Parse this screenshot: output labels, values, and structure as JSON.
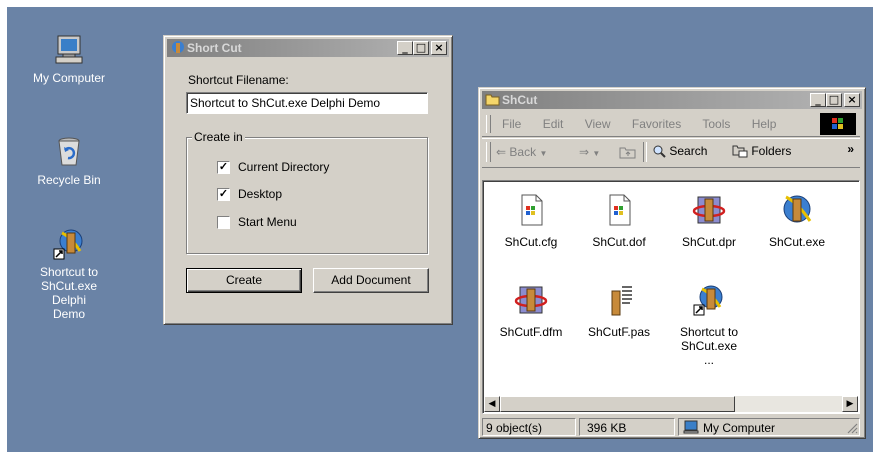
{
  "desktop": {
    "background": "#6a83a6",
    "icons": [
      {
        "label": "My Computer",
        "icon": "my-computer-icon"
      },
      {
        "label": "Recycle Bin",
        "icon": "recycle-bin-icon"
      },
      {
        "label": "Shortcut to ShCut.exe Delphi Demo",
        "icon": "delphi-shortcut-icon"
      }
    ]
  },
  "dialog": {
    "title": "Short Cut",
    "filename_label": "Shortcut Filename:",
    "filename_value": "Shortcut to ShCut.exe Delphi Demo",
    "group_label": "Create in",
    "options": [
      {
        "label": "Current Directory",
        "checked": true
      },
      {
        "label": "Desktop",
        "checked": true
      },
      {
        "label": "Start Menu",
        "checked": false
      }
    ],
    "create_label": "Create",
    "add_document_label": "Add Document",
    "minimize_glyph": "_",
    "maximize_glyph": "□",
    "close_glyph": "×"
  },
  "explorer": {
    "title": "ShCut",
    "menu": [
      "File",
      "Edit",
      "View",
      "Favorites",
      "Tools",
      "Help"
    ],
    "toolbar": {
      "back_label": "Back",
      "search_label": "Search",
      "folders_label": "Folders",
      "chevron": "»"
    },
    "files": [
      {
        "name": "ShCut.cfg",
        "icon": "config-file-icon"
      },
      {
        "name": "ShCut.dof",
        "icon": "config-file-icon"
      },
      {
        "name": "ShCut.dpr",
        "icon": "delphi-project-icon"
      },
      {
        "name": "ShCut.exe",
        "icon": "delphi-app-icon"
      },
      {
        "name": "ShCutF.dfm",
        "icon": "delphi-form-icon"
      },
      {
        "name": "ShCutF.pas",
        "icon": "pascal-unit-icon"
      },
      {
        "name": "Shortcut to ShCut.exe ...",
        "icon": "delphi-shortcut-icon"
      }
    ],
    "status": {
      "objects": "9 object(s)",
      "size": "396 KB",
      "zone": "My Computer"
    }
  }
}
